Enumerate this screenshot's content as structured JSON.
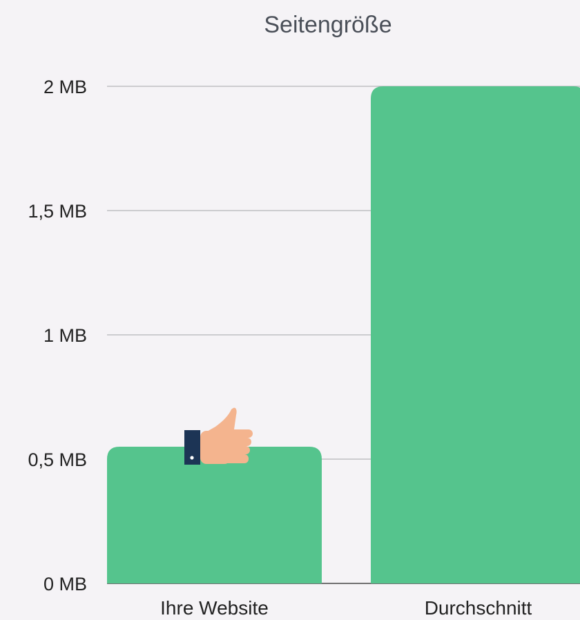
{
  "chart_data": {
    "type": "bar",
    "title": "Seitengröße",
    "xlabel": "",
    "ylabel": "",
    "categories": [
      "Ihre Website",
      "Durchschnitt"
    ],
    "values": [
      0.55,
      2.0
    ],
    "unit": "MB",
    "ylim": [
      0,
      2
    ],
    "yticks": [
      0,
      0.5,
      1,
      1.5,
      2
    ],
    "ytick_labels": [
      "0 MB",
      "0,5 MB",
      "1 MB",
      "1,5 MB",
      "2 MB"
    ],
    "grid": true,
    "bar_color": "#55c48d",
    "grid_color": "#b4b4b8"
  },
  "icons": {
    "thumbs_up": "thumbs-up-icon",
    "skin_color": "#f4b48e",
    "cuff_color": "#1c3455"
  }
}
